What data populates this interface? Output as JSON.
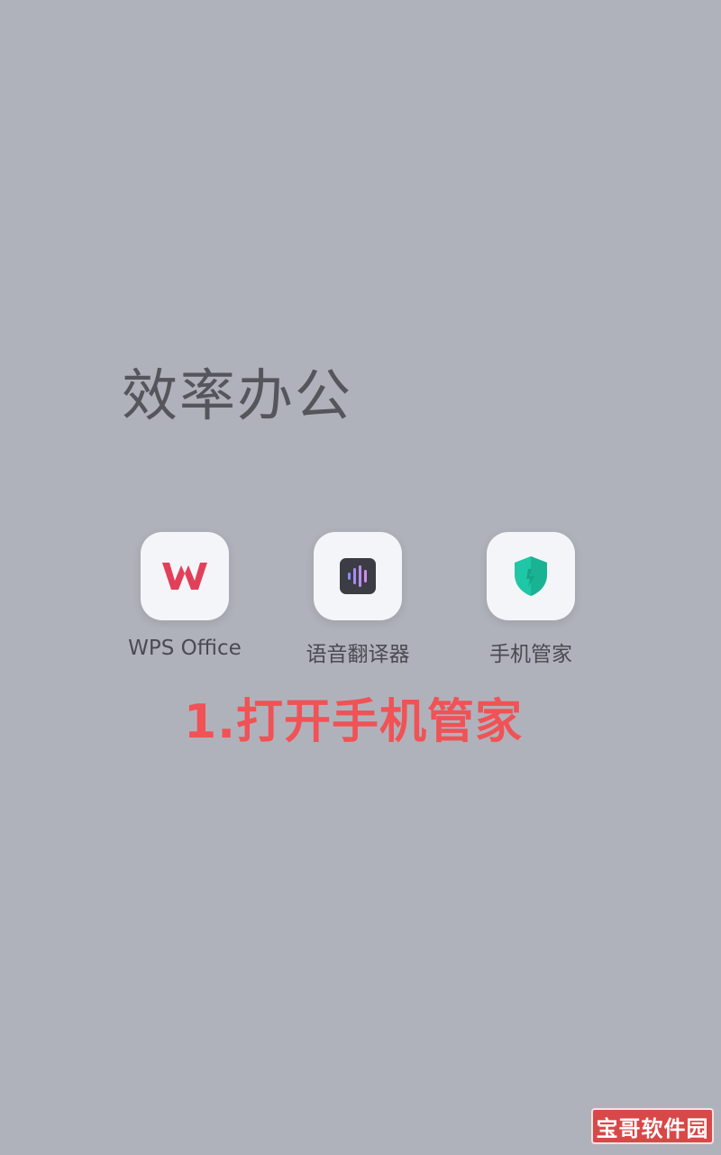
{
  "folder": {
    "title": "效率办公"
  },
  "apps": [
    {
      "label": "WPS Office",
      "icon": "wps-office-icon"
    },
    {
      "label": "语音翻译器",
      "icon": "voice-translator-icon"
    },
    {
      "label": "手机管家",
      "icon": "phone-manager-icon"
    }
  ],
  "instruction": "1.打开手机管家",
  "watermark": "宝哥软件园",
  "colors": {
    "background": "#b0b2bb",
    "wps_red": "#e2405a",
    "translator_dark": "#3b3c44",
    "manager_teal": "#1fc7a6",
    "instruction_red": "#f05256"
  }
}
